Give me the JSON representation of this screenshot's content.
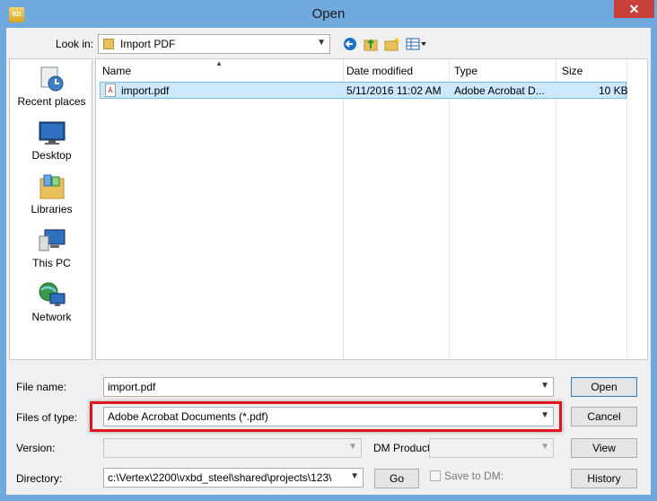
{
  "window": {
    "title": "Open",
    "close_symbol": "✕",
    "app_icon_text": "BD"
  },
  "lookin": {
    "label": "Look in:",
    "value": "Import PDF"
  },
  "places": [
    {
      "label": "Recent places",
      "icon": "recent-places-icon"
    },
    {
      "label": "Desktop",
      "icon": "desktop-icon"
    },
    {
      "label": "Libraries",
      "icon": "libraries-icon"
    },
    {
      "label": "This PC",
      "icon": "this-pc-icon"
    },
    {
      "label": "Network",
      "icon": "network-icon"
    }
  ],
  "columns": {
    "name": "Name",
    "date": "Date modified",
    "type": "Type",
    "size": "Size"
  },
  "files": [
    {
      "name": "import.pdf",
      "date": "5/11/2016 11:02 AM",
      "type": "Adobe Acrobat D...",
      "size": "10 KB"
    }
  ],
  "form": {
    "file_name_label": "File name:",
    "file_name_value": "import.pdf",
    "files_of_type_label": "Files of type:",
    "files_of_type_value": "Adobe Acrobat Documents (*.pdf)",
    "version_label": "Version:",
    "version_value": "",
    "dm_product_label": "DM Product",
    "dm_product_value": "",
    "directory_label": "Directory:",
    "directory_value": "c:\\Vertex\\2200\\vxbd_steel\\shared\\projects\\123\\",
    "save_to_dm_label": "Save to DM:"
  },
  "buttons": {
    "open": "Open",
    "cancel": "Cancel",
    "view": "View",
    "history": "History",
    "go": "Go"
  },
  "colors": {
    "title_bg": "#6fa9de",
    "close_bg": "#c7413a",
    "highlight_box": "#e0141e",
    "selection_bg": "#cce8ff"
  }
}
